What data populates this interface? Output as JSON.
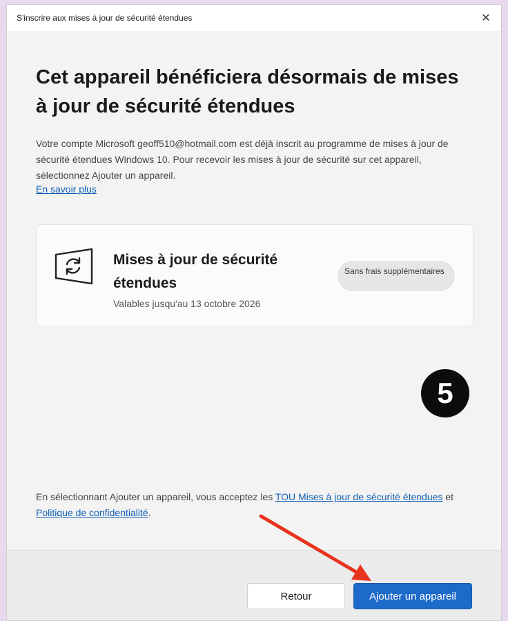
{
  "window": {
    "title": "S'inscrire aux mises à jour de sécurité étendues",
    "close_symbol": "✕"
  },
  "main": {
    "heading": "Cet appareil bénéficiera désormais de mises à jour de sécurité étendues",
    "description": "Votre compte Microsoft geoff510@hotmail.com est déjà inscrit au programme de mises à jour de sécurité étendues Windows 10. Pour recevoir les mises à jour de sécurité sur cet appareil, sélectionnez Ajouter un appareil.",
    "learn_more": "En savoir plus"
  },
  "card": {
    "icon": "windows-refresh-icon",
    "title": "Mises à jour de sécurité étendues",
    "subtitle": "Valables jusqu'au 13 octobre 2026",
    "badge": "Sans frais supplémentaires"
  },
  "annotation": {
    "step_number": "5",
    "arrow_color": "#e8321e"
  },
  "terms": {
    "prefix": "En sélectionnant Ajouter un appareil, vous acceptez les ",
    "tou_link": "TOU Mises à jour de sécurité étendues",
    "middle": " et ",
    "privacy_link": "Politique de confidentialité",
    "suffix": "."
  },
  "footer": {
    "back_label": "Retour",
    "add_label": "Ajouter un appareil"
  },
  "colors": {
    "accent": "#1c6ac9",
    "link": "#0f5fb5",
    "background": "#f3f3f3"
  }
}
